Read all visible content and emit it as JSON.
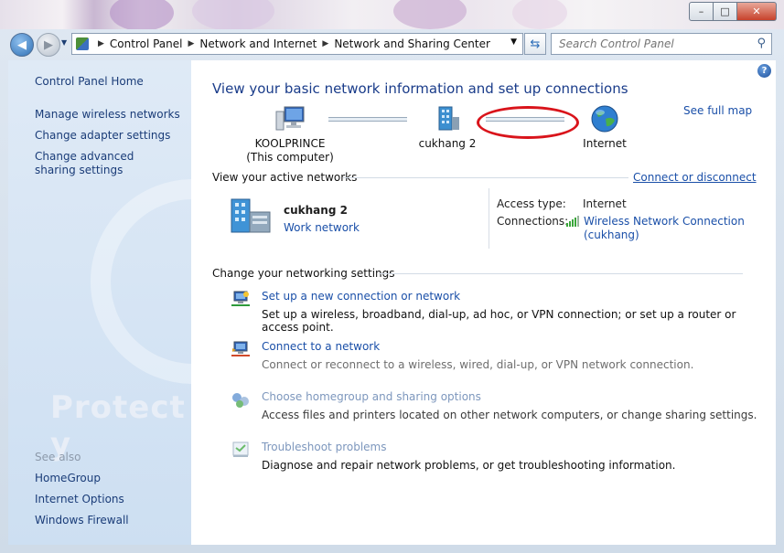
{
  "window": {
    "controls": {
      "minimize": "–",
      "maximize": "□",
      "close": "✕"
    }
  },
  "address": {
    "crumbs": [
      "Control Panel",
      "Network and Internet",
      "Network and Sharing Center"
    ],
    "search_placeholder": "Search Control Panel"
  },
  "sidebar": {
    "home": "Control Panel Home",
    "links": [
      "Manage wireless networks",
      "Change adapter settings",
      "Change advanced sharing settings"
    ],
    "see_also_label": "See also",
    "see_also": [
      "HomeGroup",
      "Internet Options",
      "Windows Firewall"
    ],
    "watermark": "Protect y"
  },
  "main": {
    "heading": "View your basic network information and set up connections",
    "see_full_map": "See full map",
    "map": {
      "computer_name": "KOOLPRINCE",
      "computer_sub": "(This computer)",
      "network_name": "cukhang  2",
      "internet": "Internet"
    },
    "active_networks": {
      "label": "View your active networks",
      "connect_disconnect": "Connect or disconnect",
      "network_name": "cukhang  2",
      "network_type": "Work network",
      "access_type_label": "Access type:",
      "access_type_value": "Internet",
      "connections_label": "Connections:",
      "connection_line1": "Wireless Network Connection",
      "connection_line2": "(cukhang)"
    },
    "change_settings": {
      "label": "Change your networking settings",
      "tasks": [
        {
          "title": "Set up a new connection or network",
          "desc": "Set up a wireless, broadband, dial-up, ad hoc, or VPN connection; or set up a router or access point."
        },
        {
          "title": "Connect to a network",
          "desc": "Connect or reconnect to a wireless, wired, dial-up, or VPN network connection."
        },
        {
          "title": "Choose homegroup and sharing options",
          "desc": "Access files and printers located on other network computers, or change sharing settings."
        },
        {
          "title": "Troubleshoot problems",
          "desc": "Diagnose and repair network problems, or get troubleshooting information."
        }
      ]
    }
  },
  "colors": {
    "link": "#1a4fa8",
    "heading": "#1a3c8a",
    "annotation_ring": "#d9141b"
  }
}
